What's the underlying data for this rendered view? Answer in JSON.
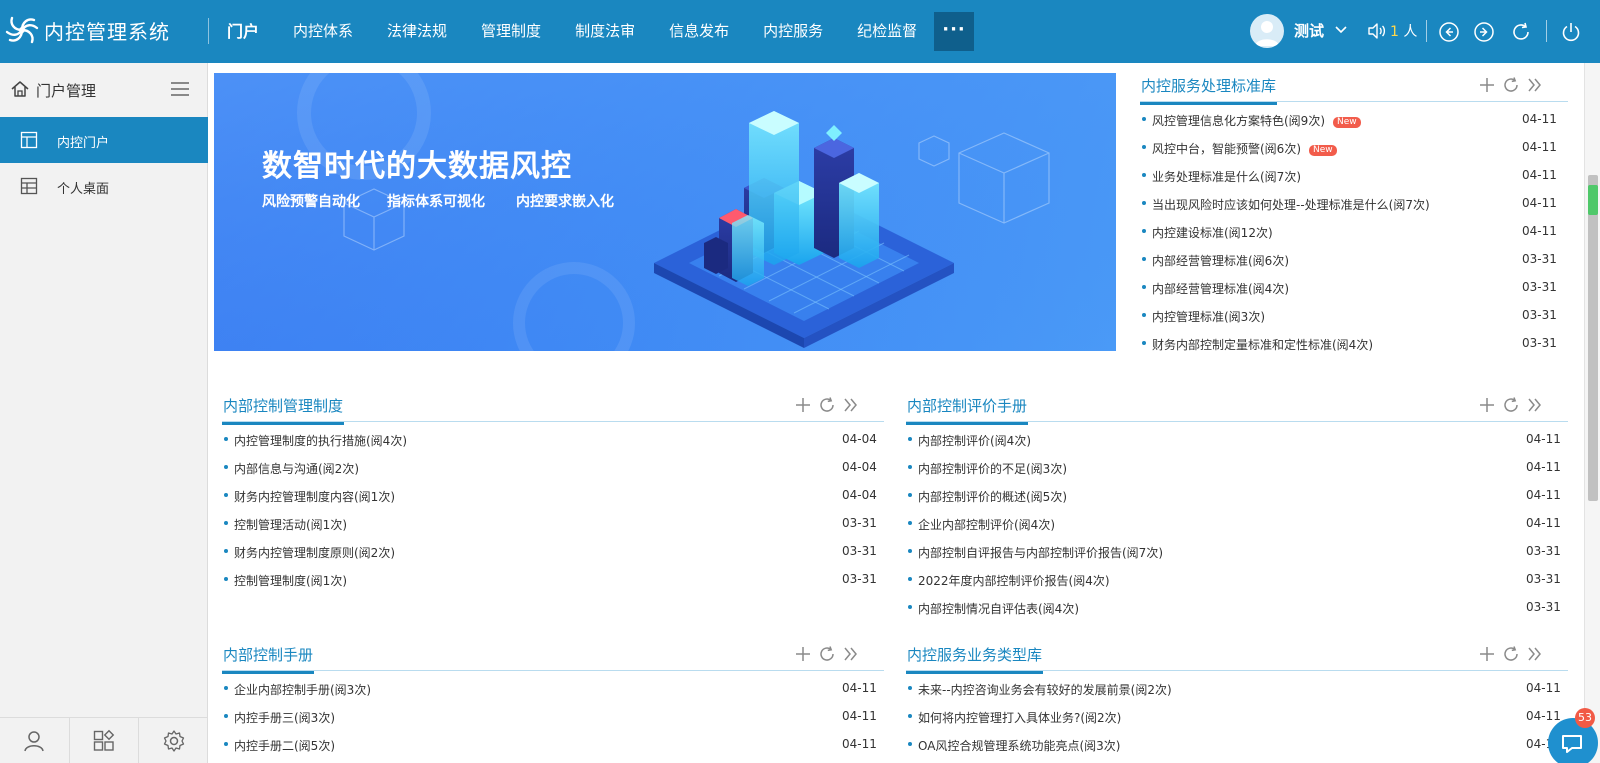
{
  "app": {
    "title": "内控管理系统"
  },
  "nav": {
    "items": [
      {
        "label": "门户",
        "active": true
      },
      {
        "label": "内控体系"
      },
      {
        "label": "法律法规"
      },
      {
        "label": "管理制度"
      },
      {
        "label": "制度法审"
      },
      {
        "label": "信息发布"
      },
      {
        "label": "内控服务"
      },
      {
        "label": "纪检监督"
      }
    ],
    "more_label": "···"
  },
  "user": {
    "name": "测试",
    "online_count": "1",
    "online_unit": "人"
  },
  "sidebar": {
    "title": "门户管理",
    "items": [
      {
        "label": "内控门户",
        "active": true,
        "icon": "portal-layout-icon"
      },
      {
        "label": "个人桌面",
        "icon": "desktop-table-icon"
      }
    ],
    "footer": [
      "user-icon",
      "apps-icon",
      "settings-icon"
    ]
  },
  "banner": {
    "title": "数智时代的大数据风控",
    "subtitles": [
      "风险预警自动化",
      "指标体系可视化",
      "内控要求嵌入化"
    ]
  },
  "panels": {
    "standards": {
      "title": "内控服务处理标准库",
      "new_label": "New",
      "items": [
        {
          "text": "风控管理信息化方案特色(阅9次)",
          "date": "04-11",
          "isNew": true
        },
        {
          "text": "风控中台，智能预警(阅6次)",
          "date": "04-11",
          "isNew": true
        },
        {
          "text": "业务处理标准是什么(阅7次)",
          "date": "04-11"
        },
        {
          "text": "当出现风险时应该如何处理--处理标准是什么(阅7次)",
          "date": "04-11"
        },
        {
          "text": "内控建设标准(阅12次)",
          "date": "04-11"
        },
        {
          "text": "内部经营管理标准(阅6次)",
          "date": "03-31"
        },
        {
          "text": "内部经营管理标准(阅4次)",
          "date": "03-31"
        },
        {
          "text": "内控管理标准(阅3次)",
          "date": "03-31"
        },
        {
          "text": "财务内部控制定量标准和定性标准(阅4次)",
          "date": "03-31"
        }
      ]
    },
    "management": {
      "title": "内部控制管理制度",
      "items": [
        {
          "text": "内控管理制度的执行措施(阅4次)",
          "date": "04-04"
        },
        {
          "text": "内部信息与沟通(阅2次)",
          "date": "04-04"
        },
        {
          "text": "财务内控管理制度内容(阅1次)",
          "date": "04-04"
        },
        {
          "text": "控制管理活动(阅1次)",
          "date": "03-31"
        },
        {
          "text": "财务内控管理制度原则(阅2次)",
          "date": "03-31"
        },
        {
          "text": "控制管理制度(阅1次)",
          "date": "03-31"
        }
      ]
    },
    "evaluation": {
      "title": "内部控制评价手册",
      "items": [
        {
          "text": "内部控制评价(阅4次)",
          "date": "04-11"
        },
        {
          "text": "内部控制评价的不足(阅3次)",
          "date": "04-11"
        },
        {
          "text": "内部控制评价的概述(阅5次)",
          "date": "04-11"
        },
        {
          "text": "企业内部控制评价(阅4次)",
          "date": "04-11"
        },
        {
          "text": "内部控制自评报告与内部控制评价报告(阅7次)",
          "date": "03-31"
        },
        {
          "text": "2022年度内部控制评价报告(阅4次)",
          "date": "03-31"
        },
        {
          "text": "内部控制情况自评估表(阅4次)",
          "date": "03-31"
        }
      ]
    },
    "manual": {
      "title": "内部控制手册",
      "items": [
        {
          "text": "企业内部控制手册(阅3次)",
          "date": "04-11"
        },
        {
          "text": "内控手册三(阅3次)",
          "date": "04-11"
        },
        {
          "text": "内控手册二(阅5次)",
          "date": "04-11"
        }
      ]
    },
    "business": {
      "title": "内控服务业务类型库",
      "items": [
        {
          "text": "未来--内控咨询业务会有较好的发展前景(阅2次)",
          "date": "04-11"
        },
        {
          "text": "如何将内控管理打入具体业务?(阅2次)",
          "date": "04-11"
        },
        {
          "text": "OA风控合规管理系统功能亮点(阅3次)",
          "date": "04-11"
        }
      ]
    }
  },
  "chat": {
    "badge": "53"
  },
  "colors": {
    "primary": "#1a87c0",
    "new_badge": "#f25c4b",
    "online_count": "#ffd84a"
  }
}
